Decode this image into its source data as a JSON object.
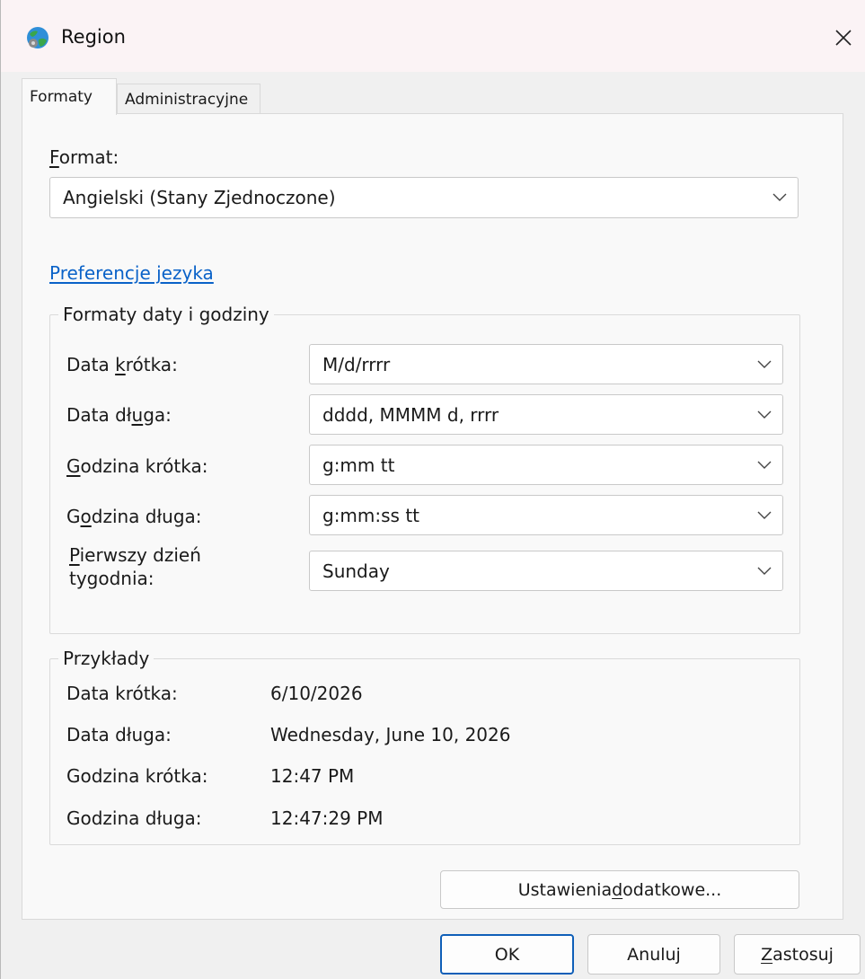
{
  "window": {
    "title": "Region",
    "close_glyph": "✕"
  },
  "tabs": [
    {
      "label": "Formaty",
      "active": true
    },
    {
      "label": "Administracyjne",
      "active": false
    }
  ],
  "format": {
    "label_accel": "F",
    "label_rest": "ormat:",
    "value": "Angielski (Stany Zjednoczone)"
  },
  "language_prefs_link": "Preferencje jezyka",
  "date_time_formats": {
    "title": "Formaty daty i godziny",
    "rows": [
      {
        "label_pre": "Data ",
        "label_accel": "k",
        "label_post": "rótka:",
        "value": "M/d/rrrr"
      },
      {
        "label_pre": "Data dł",
        "label_accel": "u",
        "label_post": "ga:",
        "value": "dddd, MMMM d, rrrr"
      },
      {
        "label_pre": "",
        "label_accel": "G",
        "label_post": "odzina krótka:",
        "value": "g:mm tt"
      },
      {
        "label_pre": "G",
        "label_accel": "o",
        "label_post": "dzina długa:",
        "value": "g:mm:ss tt"
      }
    ],
    "first_day": {
      "label_line1_accel": "P",
      "label_line1_rest": "ierwszy dzień",
      "label_line2": "tygodnia:",
      "value": "Sunday"
    }
  },
  "examples": {
    "title": "Przykłady",
    "rows": [
      {
        "label": "Data krótka:",
        "value": "6/10/2026"
      },
      {
        "label": "Data długa:",
        "value": "Wednesday, June 10, 2026"
      },
      {
        "label": "Godzina krótka:",
        "value": "12:47 PM"
      },
      {
        "label": "Godzina długa:",
        "value": "12:47:29 PM"
      }
    ]
  },
  "buttons": {
    "additional_pre": "Ustawienia ",
    "additional_accel": "d",
    "additional_post": "odatkowe...",
    "ok": "OK",
    "cancel": "Anuluj",
    "apply_accel": "Z",
    "apply_rest": "astosuj"
  },
  "colors": {
    "link": "#0a62c8",
    "primary_border": "#0f5fb8",
    "titlebar_bg": "#fbf3f5"
  },
  "icons": {
    "title": "globe-region-icon",
    "close": "close-icon",
    "dropdown": "chevron-down-icon"
  }
}
